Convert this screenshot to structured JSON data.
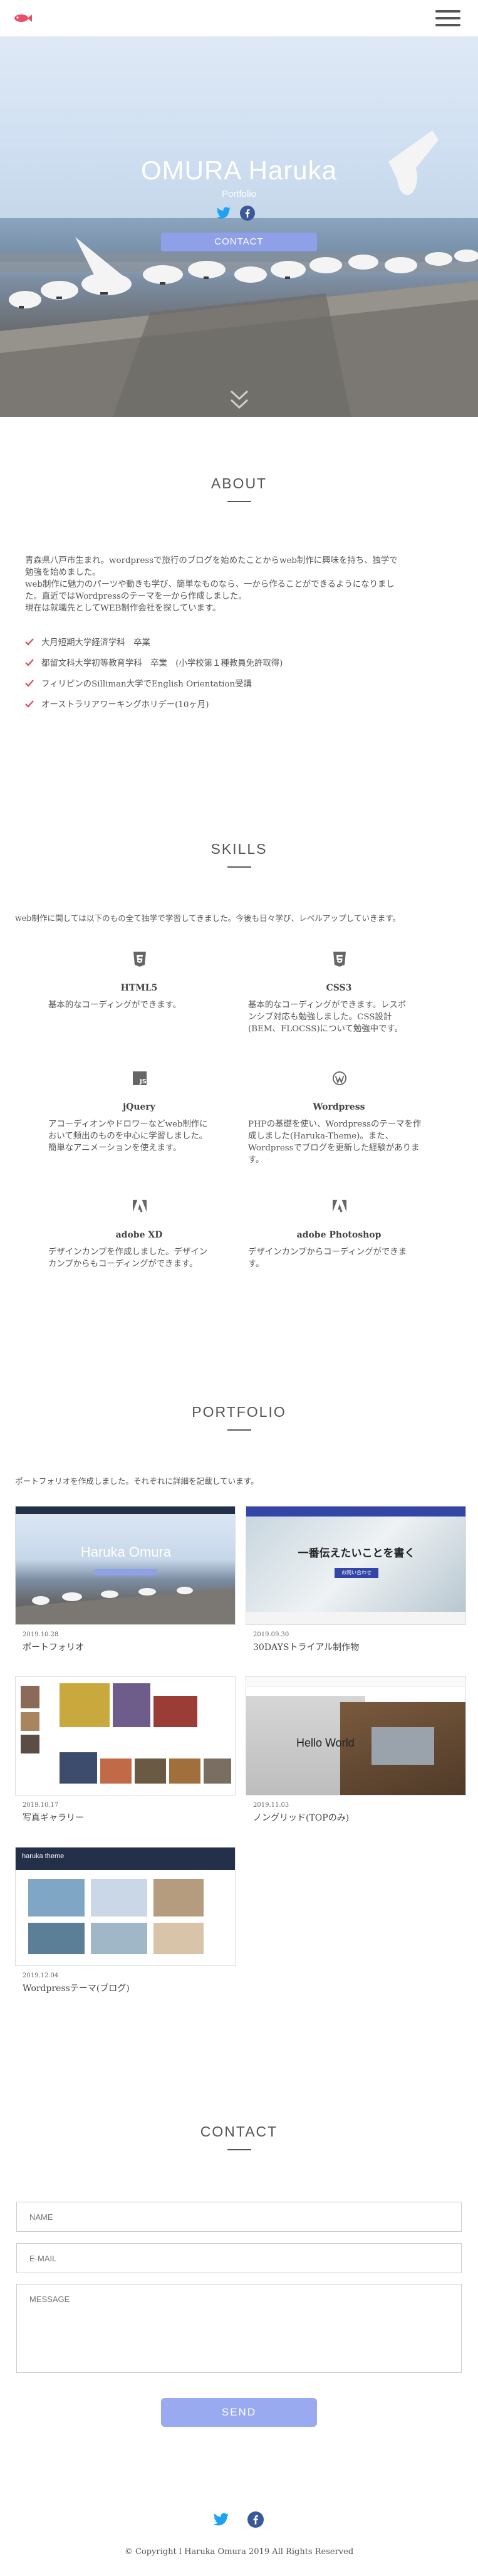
{
  "header": {
    "logo_icon": "fish-logo-icon",
    "menu_icon": "hamburger-icon"
  },
  "hero": {
    "title": "OMURA Haruka",
    "subtitle": "Portfolio",
    "social": [
      "twitter-icon",
      "facebook-icon"
    ],
    "contact_label": "CONTACT",
    "scroll_icon": "double-chevron-down-icon"
  },
  "about": {
    "heading": "ABOUT",
    "intro_lines": [
      "青森県八戸市生まれ。wordpressで旅行のブログを始めたことからweb制作に興味を持ち、独学で",
      "勉強を始めました。",
      "web制作に魅力のパーツや動きも学び、簡単なものなら、一から作ることができるようになりまし",
      "た。直近ではWordpressのテーマを一から作成しました。",
      "現在は就職先としてWEB制作会社を探しています。"
    ],
    "checklist": [
      "大月短期大学経済学科　卒業",
      "都留文科大学初等教育学科　卒業　(小学校第１種教員免許取得)",
      "フィリピンのSilliman大学でEnglish Orientation受講",
      "オーストラリアワーキングホリデー(10ヶ月)"
    ]
  },
  "skills": {
    "heading": "SKILLS",
    "intro": "web制作に関しては以下のもの全て独学で学習してきました。今後も日々学び、レベルアップしていきます。",
    "items": [
      {
        "name": "HTML5",
        "icon": "html5-icon",
        "desc": [
          "基本的なコーディングができます。"
        ]
      },
      {
        "name": "CSS3",
        "icon": "css3-icon",
        "desc": [
          "基本的なコーディングができます。レスポ",
          "ンシブ対応も勉強しました。CSS設計",
          "(BEM、FLOCSS)について勉強中です。"
        ]
      },
      {
        "name": "jQuery",
        "icon": "js-icon",
        "desc": [
          "アコーディオンやドロワーなどweb制作に",
          "おいて頻出のものを中心に学習しました。",
          "簡単なアニメーションを使えます。"
        ]
      },
      {
        "name": "Wordpress",
        "icon": "wordpress-icon",
        "desc": [
          "PHPの基礎を使い、Wordpressのテーマを作",
          "成しました(Haruka-Theme)。また、",
          "Wordpressでブログを更新した経験がありま",
          "す。"
        ]
      },
      {
        "name": "adobe XD",
        "icon": "adobe-icon",
        "desc": [
          "デザインカンプを作成しました。デザイン",
          "カンプからもコーディングができます。"
        ]
      },
      {
        "name": "adobe Photoshop",
        "icon": "adobe-icon",
        "desc": [
          "デザインカンプからコーディングができま",
          "す。"
        ]
      }
    ]
  },
  "portfolio": {
    "heading": "PORTFOLIO",
    "intro": "ポートフォリオを作成しました。それぞれに詳細を記載しています。",
    "cards": [
      {
        "date": "2019.10.28",
        "title": "ポートフォリオ",
        "thumb_title": "Haruka Omura"
      },
      {
        "date": "2019.09.30",
        "title": "30DAYSトライアル制作物",
        "thumb_title": "一番伝えたいことを書く",
        "thumb_btn": "お問い合わせ"
      },
      {
        "date": "2019.10.17",
        "title": "写真ギャラリー"
      },
      {
        "date": "2019.11.03",
        "title": "ノングリッド(TOPのみ)",
        "thumb_title": "Hello World"
      },
      {
        "date": "2019.12.04",
        "title": "Wordpressテーマ(ブログ)",
        "thumb_title": "haruka theme"
      }
    ]
  },
  "contact": {
    "heading": "CONTACT",
    "name_placeholder": "NAME",
    "email_placeholder": "E-MAIL",
    "message_placeholder": "MESSAGE",
    "send_label": "SEND"
  },
  "footer": {
    "social": [
      "twitter-icon",
      "facebook-icon"
    ],
    "copyright": "© Copyright l Haruka Omura 2019 All Rights Reserved"
  },
  "colors": {
    "accent": "#8fa0e8",
    "check": "#e0506a",
    "twitter": "#1da1f2",
    "facebook": "#3b5998"
  }
}
